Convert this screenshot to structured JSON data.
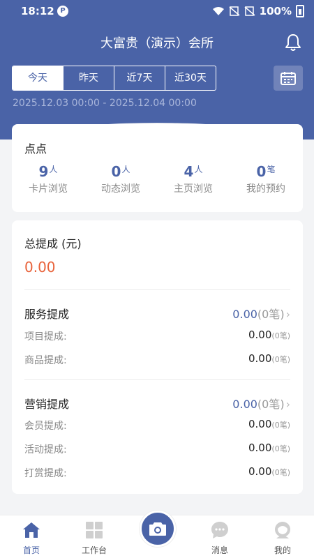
{
  "status_bar": {
    "time": "18:12",
    "battery": "100%"
  },
  "header": {
    "title": "大富贵（演示）会所",
    "tabs": [
      {
        "label": "今天",
        "active": true
      },
      {
        "label": "昨天",
        "active": false
      },
      {
        "label": "近7天",
        "active": false
      },
      {
        "label": "近30天",
        "active": false
      }
    ],
    "date_range": "2025.12.03 00:00 - 2025.12.04 00:00"
  },
  "shop": {
    "name": "点点",
    "stats": [
      {
        "value": "9",
        "unit": "人",
        "label": "卡片浏览"
      },
      {
        "value": "0",
        "unit": "人",
        "label": "动态浏览"
      },
      {
        "value": "4",
        "unit": "人",
        "label": "主页浏览"
      },
      {
        "value": "0",
        "unit": "笔",
        "label": "我的预约"
      }
    ]
  },
  "commission": {
    "total_label": "总提成 (元)",
    "total_value": "0.00",
    "service": {
      "title": "服务提成",
      "value": "0.00",
      "count": "(0笔)",
      "rows": [
        {
          "label": "项目提成:",
          "value": "0.00",
          "count": "(0笔)"
        },
        {
          "label": "商品提成:",
          "value": "0.00",
          "count": "(0笔)"
        }
      ]
    },
    "marketing": {
      "title": "营销提成",
      "value": "0.00",
      "count": "(0笔)",
      "rows": [
        {
          "label": "会员提成:",
          "value": "0.00",
          "count": "(0笔)"
        },
        {
          "label": "活动提成:",
          "value": "0.00",
          "count": "(0笔)"
        },
        {
          "label": "打赏提成:",
          "value": "0.00",
          "count": "(0笔)"
        }
      ]
    }
  },
  "tabbar": [
    {
      "label": "首页",
      "icon": "home-icon",
      "active": true
    },
    {
      "label": "工作台",
      "icon": "grid-icon",
      "active": false
    },
    {
      "label": "",
      "icon": "camera-icon",
      "active": false
    },
    {
      "label": "消息",
      "icon": "chat-icon",
      "active": false
    },
    {
      "label": "我的",
      "icon": "profile-icon",
      "active": false
    }
  ],
  "colors": {
    "primary": "#4a63a7",
    "accent": "#e8623a",
    "background": "#f3f4f6"
  }
}
